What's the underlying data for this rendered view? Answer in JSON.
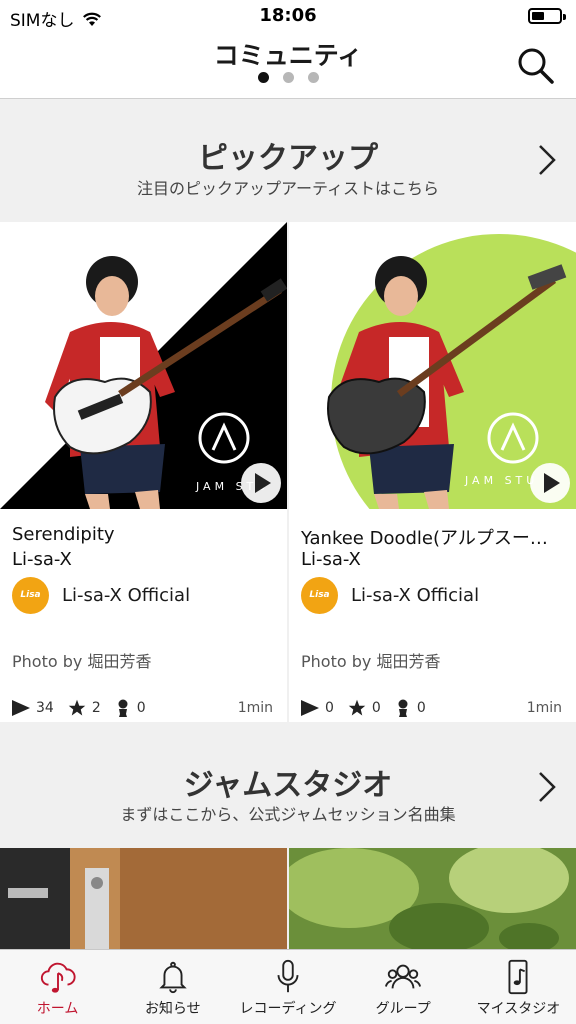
{
  "status_bar": {
    "carrier": "SIMなし",
    "time": "18:06",
    "battery_level": 0.45
  },
  "nav": {
    "title": "コミュニティ",
    "page_count": 3,
    "active_page": 1,
    "search_icon": "search-icon"
  },
  "pickup": {
    "title": "ピックアップ",
    "subtitle": "注目のピックアップアーティストはこちら",
    "cards": [
      {
        "title": "Serendipity",
        "artist": "Li-sa-X",
        "owner": "Li-sa-X Official",
        "photo_credit": "Photo by 堀田芳香",
        "plays": "34",
        "stars": "2",
        "members": "0",
        "duration": "1min"
      },
      {
        "title": "Yankee Doodle(アルプスー…",
        "artist": "Li-sa-X",
        "owner": "Li-sa-X Official",
        "photo_credit": "Photo by 堀田芳香",
        "plays": "0",
        "stars": "0",
        "members": "0",
        "duration": "1min"
      }
    ]
  },
  "jam_studio": {
    "title": "ジャムスタジオ",
    "subtitle": "まずはここから、公式ジャムセッション名曲集"
  },
  "tabs": [
    {
      "label": "ホーム",
      "icon": "cloud-music-icon",
      "active": true
    },
    {
      "label": "お知らせ",
      "icon": "bell-icon",
      "active": false
    },
    {
      "label": "レコーディング",
      "icon": "microphone-icon",
      "active": false
    },
    {
      "label": "グループ",
      "icon": "group-icon",
      "active": false
    },
    {
      "label": "マイスタジオ",
      "icon": "phone-music-icon",
      "active": false
    }
  ],
  "colors": {
    "accent": "#c0152f",
    "card_bg_green": "#b9e05a",
    "avatar": "#f2a413"
  }
}
